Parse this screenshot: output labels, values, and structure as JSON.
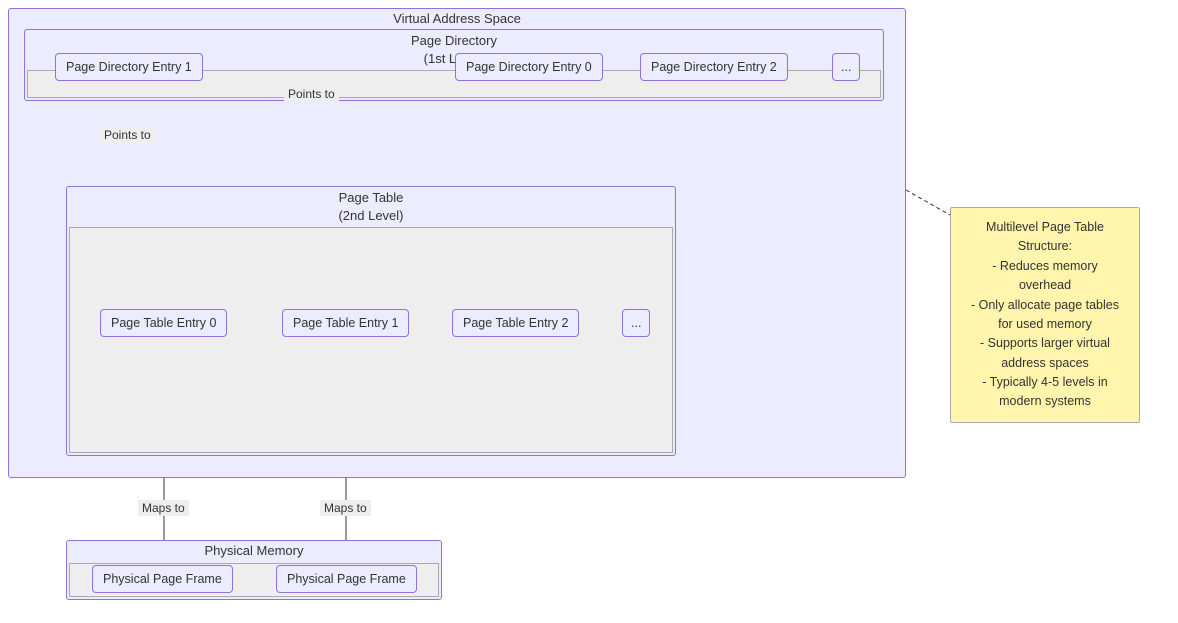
{
  "vas": {
    "title": "Virtual Address Space"
  },
  "page_directory": {
    "title": "Page Directory",
    "subtitle": "(1st Level)",
    "entries": [
      "Page Directory Entry 0",
      "Page Directory Entry 1",
      "Page Directory Entry 2",
      "..."
    ]
  },
  "page_table": {
    "title": "Page Table",
    "subtitle": "(2nd Level)",
    "entries": [
      "Page Table Entry 0",
      "Page Table Entry 1",
      "Page Table Entry 2",
      "..."
    ]
  },
  "physical_memory": {
    "title": "Physical Memory",
    "frames": [
      "Physical Page Frame",
      "Physical Page Frame"
    ]
  },
  "edges": {
    "pde0_to_pt": "Points to",
    "pde1_to_pt": "Points to",
    "pte0_to_frame": "Maps to",
    "pte1_to_frame": "Maps to"
  },
  "note": {
    "title": "Multilevel Page Table",
    "subtitle": "Structure:",
    "lines": [
      "- Reduces memory",
      "overhead",
      "- Only allocate page tables",
      "for used memory",
      "- Supports larger virtual",
      "address spaces",
      "- Typically 4-5 levels in",
      "modern systems"
    ]
  }
}
